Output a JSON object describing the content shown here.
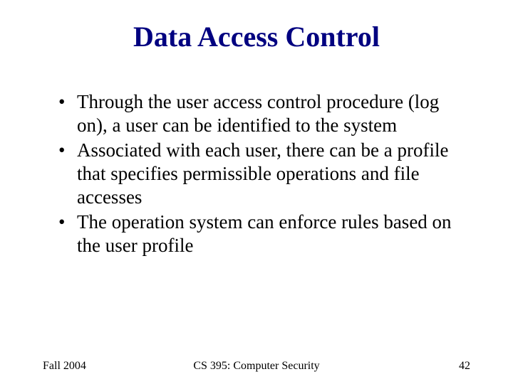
{
  "title": "Data Access Control",
  "bullets": {
    "b0": "Through the user access control procedure (log on), a user can be identified to the system",
    "b1": "Associated with each user, there can be a profile that specifies permissible operations and file accesses",
    "b2": "The operation system can enforce rules based on the user profile"
  },
  "footer": {
    "left": "Fall 2004",
    "center": "CS 395: Computer Security",
    "right": "42"
  }
}
